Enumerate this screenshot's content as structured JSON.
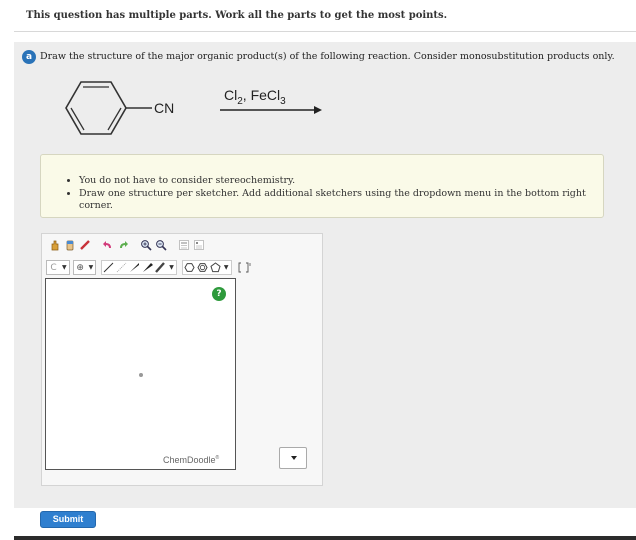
{
  "header": {
    "instruction": "This question has multiple parts. Work all the parts to get the most points."
  },
  "part": {
    "badge": "a",
    "question": "Draw the structure of the major organic product(s) of the following reaction. Consider monosubstitution products only."
  },
  "reaction": {
    "substituent": "CN",
    "reagent_cl": "Cl",
    "reagent_cl_sub": "2",
    "reagent_sep": ", ",
    "reagent_fe": "FeCl",
    "reagent_fe_sub": "3"
  },
  "info": {
    "bullets": [
      "You do not have to consider stereochemistry.",
      "Draw one structure per sketcher. Add additional sketchers using the dropdown menu in the bottom right corner."
    ]
  },
  "sketcher": {
    "toolbar_row1": [
      "hand-icon",
      "eraser-icon",
      "pen-icon",
      "undo-icon",
      "redo-icon",
      "zoom-in-icon",
      "zoom-out-icon",
      "clean-icon",
      "periodic-table-icon"
    ],
    "element_label": "C",
    "charge_label": "⊕",
    "help_label": "?",
    "brand": "ChemDoodle",
    "brand_mark": "®"
  },
  "actions": {
    "submit_label": "Submit"
  }
}
